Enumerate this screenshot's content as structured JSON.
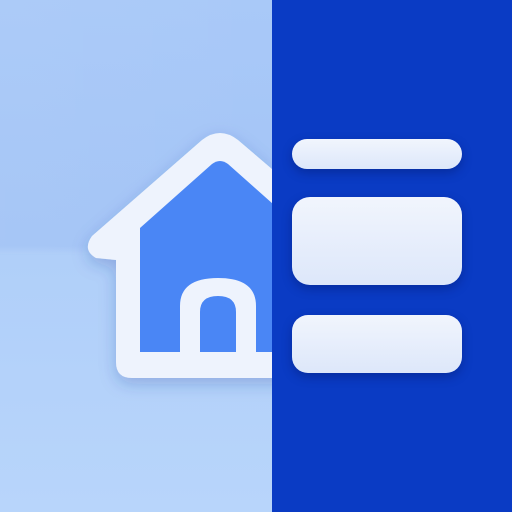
{
  "icon": {
    "name": "home-split-layout-icon",
    "colors": {
      "left_panel": "#a9c9f8",
      "right_panel": "#0a3bc4",
      "house_outline": "#eef3fd",
      "house_fill": "#4a86f5",
      "bars": "#e6edfb"
    },
    "elements": [
      "home-icon",
      "list-bars"
    ]
  }
}
